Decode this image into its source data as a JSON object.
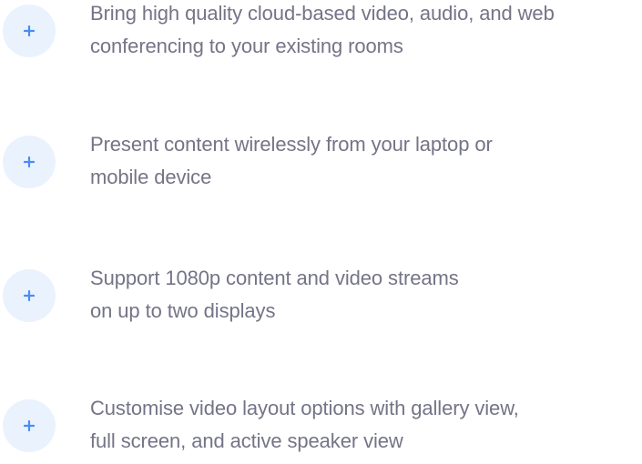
{
  "features": [
    {
      "icon": "plus-icon",
      "line1": "Bring high quality cloud-based video, audio, and web",
      "line2": "conferencing to your existing rooms"
    },
    {
      "icon": "plus-icon",
      "line1": "Present content wirelessly from your laptop or",
      "line2": "mobile device"
    },
    {
      "icon": "plus-icon",
      "line1": "Support 1080p content and video streams",
      "line2": "on up to two displays"
    },
    {
      "icon": "plus-icon",
      "line1": "Customise video layout options with gallery view,",
      "line2": "full screen, and active speaker view"
    }
  ],
  "colors": {
    "accent": "#4a8cf7",
    "badge_bg": "#eaf2fe",
    "text": "#747487"
  }
}
